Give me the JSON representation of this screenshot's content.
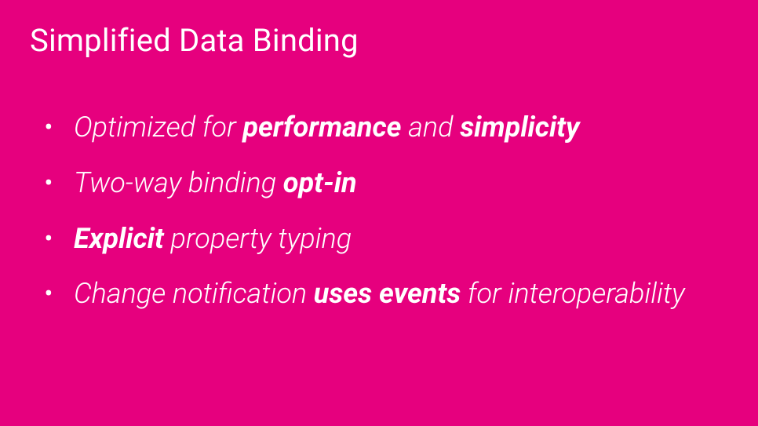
{
  "slide": {
    "title": "Simplified Data Binding",
    "bullets": [
      {
        "segments": [
          {
            "text": "Optimized for ",
            "bold": false
          },
          {
            "text": "performance",
            "bold": true
          },
          {
            "text": " and ",
            "bold": false
          },
          {
            "text": "simplicity",
            "bold": true
          }
        ]
      },
      {
        "segments": [
          {
            "text": "Two-way binding ",
            "bold": false
          },
          {
            "text": "opt-in",
            "bold": true
          }
        ]
      },
      {
        "segments": [
          {
            "text": "Explicit",
            "bold": true
          },
          {
            "text": " property typing",
            "bold": false
          }
        ]
      },
      {
        "segments": [
          {
            "text": "Change notification ",
            "bold": false
          },
          {
            "text": "uses events",
            "bold": true
          },
          {
            "text": " for interoperability",
            "bold": false
          }
        ]
      }
    ]
  }
}
